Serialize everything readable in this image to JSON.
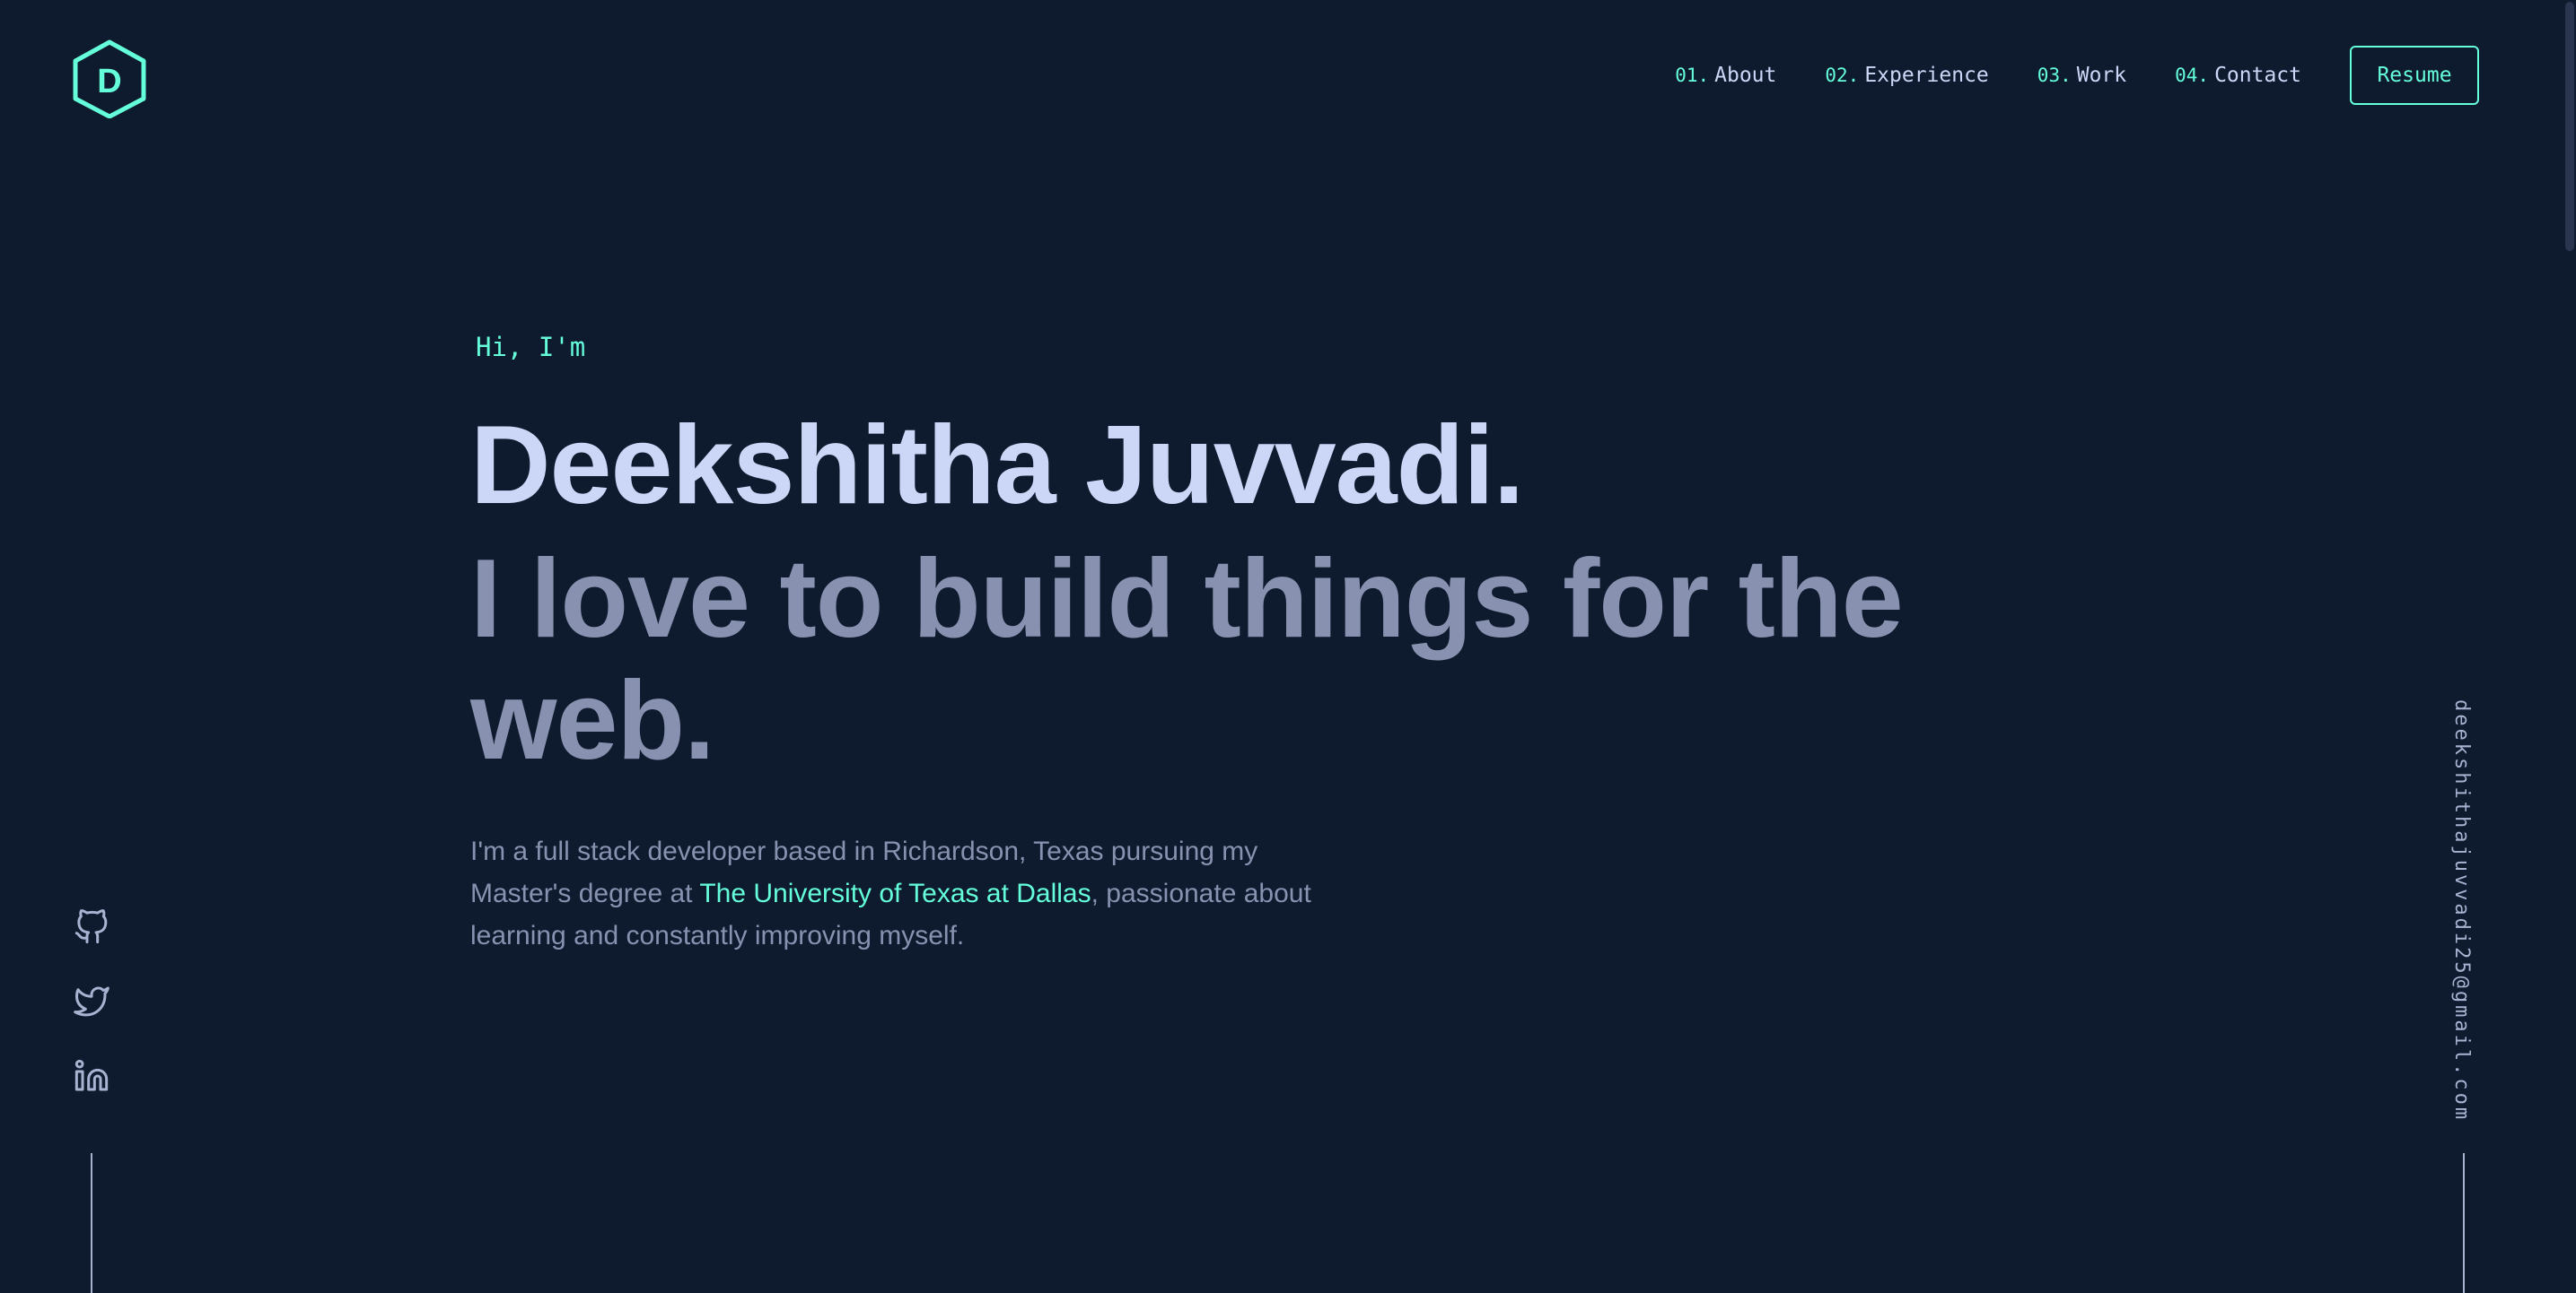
{
  "header": {
    "logo_letter": "D",
    "nav": [
      {
        "num": "01.",
        "label": "About"
      },
      {
        "num": "02.",
        "label": "Experience"
      },
      {
        "num": "03.",
        "label": "Work"
      },
      {
        "num": "04.",
        "label": "Contact"
      }
    ],
    "resume_label": "Resume"
  },
  "hero": {
    "greeting": "Hi, I'm",
    "name": "Deekshitha Juvvadi.",
    "tagline": "I love to build things for the web.",
    "bio_before": "I'm a full stack developer based in Richardson, Texas pursuing my Master's degree at ",
    "bio_link": "The University of Texas at Dallas",
    "bio_after": ", passionate about learning and constantly improving myself."
  },
  "social": [
    {
      "icon": "github-icon"
    },
    {
      "icon": "twitter-icon"
    },
    {
      "icon": "linkedin-icon"
    }
  ],
  "email": "deekshithajuvvadi25@gmail.com",
  "colors": {
    "background": "#0e1a2e",
    "accent": "#64ffda",
    "heading": "#ccd6f6",
    "muted": "#8892b0"
  }
}
